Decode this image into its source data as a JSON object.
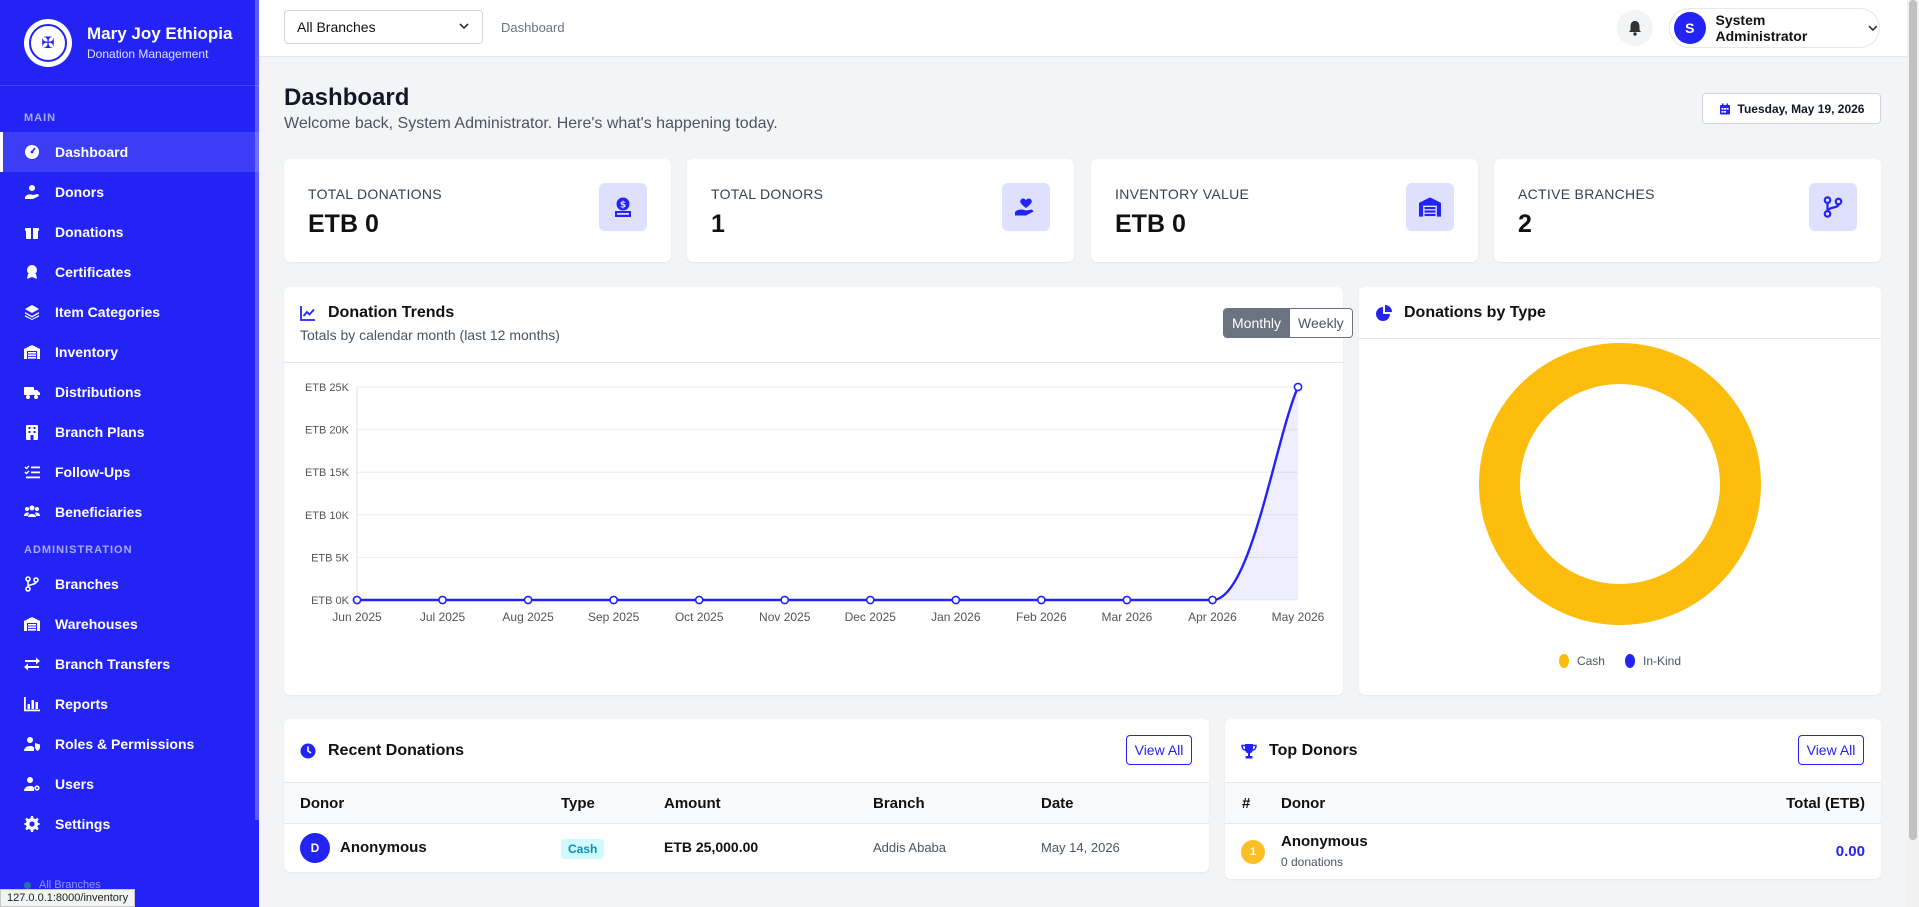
{
  "brand": {
    "title": "Mary Joy Ethiopia",
    "subtitle": "Donation Management"
  },
  "sidebar": {
    "main_label": "MAIN",
    "admin_label": "ADMINISTRATION",
    "main_items": [
      {
        "label": "Dashboard",
        "icon": "gauge-icon"
      },
      {
        "label": "Donors",
        "icon": "user-hand-icon"
      },
      {
        "label": "Donations",
        "icon": "gift-icon"
      },
      {
        "label": "Certificates",
        "icon": "award-icon"
      },
      {
        "label": "Item Categories",
        "icon": "layers-icon"
      },
      {
        "label": "Inventory",
        "icon": "warehouse-icon"
      },
      {
        "label": "Distributions",
        "icon": "truck-icon"
      },
      {
        "label": "Branch Plans",
        "icon": "building-icon"
      },
      {
        "label": "Follow-Ups",
        "icon": "list-check-icon"
      },
      {
        "label": "Beneficiaries",
        "icon": "users-icon"
      }
    ],
    "admin_items": [
      {
        "label": "Branches",
        "icon": "code-branch-icon"
      },
      {
        "label": "Warehouses",
        "icon": "warehouse-icon"
      },
      {
        "label": "Branch Transfers",
        "icon": "arrows-exchange-icon"
      },
      {
        "label": "Reports",
        "icon": "chart-bar-icon"
      },
      {
        "label": "Roles & Permissions",
        "icon": "user-shield-icon"
      },
      {
        "label": "Users",
        "icon": "user-gear-icon"
      },
      {
        "label": "Settings",
        "icon": "gear-icon"
      }
    ],
    "footer": "All Branches",
    "url_tooltip": "127.0.0.1:8000/inventory"
  },
  "topbar": {
    "branch_select": "All Branches",
    "breadcrumb": "Dashboard",
    "user_initial": "S",
    "user_name": "System Administrator"
  },
  "page": {
    "title": "Dashboard",
    "subtitle": "Welcome back, System Administrator. Here's what's happening today.",
    "date": "Tuesday, May 19, 2026"
  },
  "stats": [
    {
      "label": "TOTAL DONATIONS",
      "value": "ETB 0",
      "icon": "hand-coin-icon"
    },
    {
      "label": "TOTAL DONORS",
      "value": "1",
      "icon": "hand-heart-icon"
    },
    {
      "label": "INVENTORY VALUE",
      "value": "ETB 0",
      "icon": "warehouse-icon"
    },
    {
      "label": "ACTIVE BRANCHES",
      "value": "2",
      "icon": "code-branch-icon"
    }
  ],
  "trends": {
    "title": "Donation Trends",
    "subtitle": "Totals by calendar month (last 12 months)",
    "toggle_on": "Monthly",
    "toggle_off": "Weekly"
  },
  "by_type": {
    "title": "Donations by Type"
  },
  "chart_data": [
    {
      "type": "area",
      "x": [
        "Jun 2025",
        "Jul 2025",
        "Aug 2025",
        "Sep 2025",
        "Oct 2025",
        "Nov 2025",
        "Dec 2025",
        "Jan 2026",
        "Feb 2026",
        "Mar 2026",
        "Apr 2026",
        "May 2026"
      ],
      "values": [
        0,
        0,
        0,
        0,
        0,
        0,
        0,
        0,
        0,
        0,
        0,
        25000
      ],
      "yticks": [
        "ETB 0K",
        "ETB 5K",
        "ETB 10K",
        "ETB 15K",
        "ETB 20K",
        "ETB 25K"
      ],
      "ylim": [
        0,
        25000
      ],
      "grid": true,
      "color": "#2323f5"
    },
    {
      "type": "pie",
      "labels": [
        "Cash",
        "In-Kind"
      ],
      "values": [
        25000,
        0
      ],
      "colors": [
        "#fcbd0d",
        "#2323f5"
      ],
      "donut": true,
      "legend": "bottom"
    }
  ],
  "recent": {
    "title": "Recent Donations",
    "view_all": "View All",
    "headers": [
      "Donor",
      "Type",
      "Amount",
      "Branch",
      "Date"
    ],
    "rows": [
      {
        "initial": "D",
        "donor": "Anonymous",
        "type": "Cash",
        "amount": "ETB 25,000.00",
        "branch": "Addis Ababa",
        "date": "May 14, 2026"
      }
    ]
  },
  "top_donors": {
    "title": "Top Donors",
    "view_all": "View All",
    "headers": [
      "#",
      "Donor",
      "Total (ETB)"
    ],
    "rows": [
      {
        "rank": "1",
        "name": "Anonymous",
        "count": "0 donations",
        "total": "0.00"
      }
    ]
  }
}
